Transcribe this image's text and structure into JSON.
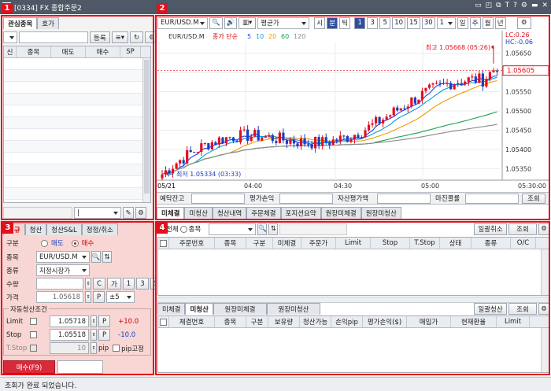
{
  "window": {
    "title": "[0334] FX 종합주문2",
    "icons": [
      "window-icon",
      "restore-icon",
      "minimize-icon",
      "link-icon",
      "font-icon",
      "help-icon",
      "settings-icon",
      "pin-icon",
      "close-icon"
    ]
  },
  "markers": [
    "1",
    "2",
    "3",
    "4"
  ],
  "watchlist": {
    "tabs": [
      "관심종목",
      "호가"
    ],
    "register_label": "등록",
    "columns": [
      "신",
      "종목",
      "매도",
      "매수",
      "SP"
    ]
  },
  "chart_toolbar": {
    "symbol": "EUR/USD.M",
    "price_type": "평균가",
    "period_buttons": [
      "시",
      "분",
      "틱"
    ],
    "intervals": [
      "1",
      "3",
      "5",
      "10",
      "15",
      "30"
    ],
    "interval_select": "1",
    "long_periods": [
      "일",
      "주",
      "월",
      "년"
    ]
  },
  "chart": {
    "legend_symbol": "EUR/USD.M",
    "legend_ma": "종가 단순",
    "ma_periods": [
      "5",
      "10",
      "20",
      "60",
      "120"
    ],
    "ma_colors": [
      "#1f3cff",
      "#0a9bd8",
      "#f29a00",
      "#17a04a",
      "#8a8a8a"
    ],
    "high_label": "최고 1.05668 (05:26)",
    "low_label": "최저 1.05334 (03:33)",
    "lc_label": "LC:0.26",
    "hc_label": "HC:-0.06",
    "current_price": "1.05605",
    "y_ticks": [
      "1.05650",
      "1.05600",
      "1.05550",
      "1.05500",
      "1.05450",
      "1.05400",
      "1.05350"
    ],
    "x_ticks": [
      "05/21",
      "04:00",
      "04:30",
      "05:00",
      "05:30:00"
    ]
  },
  "chart_data": {
    "type": "candlestick",
    "ylim": [
      1.0532,
      1.0568
    ],
    "x": [
      "05/21",
      "04:00",
      "04:30",
      "05:00",
      "05:30:00"
    ],
    "high": 1.05668,
    "low": 1.05334,
    "last": 1.05605
  },
  "account": {
    "labels": [
      "예탁잔고",
      "평가손익",
      "자산평가액",
      "마진콜률"
    ],
    "query_label": "조회"
  },
  "order_tabs": [
    "미체결",
    "미청산",
    "청산내역",
    "주문체결",
    "포지션요약",
    "원장미체결",
    "원장미청산"
  ],
  "order_panel": {
    "tabs": [
      "신규",
      "청산",
      "청산S&L",
      "정정/취소"
    ],
    "fields": {
      "side_label": "구분",
      "sell": "매도",
      "buy": "매수",
      "symbol_label": "종목",
      "symbol": "EUR/USD.M",
      "type_label": "종류",
      "type": "지정시장가",
      "qty_label": "수량",
      "qty_buttons": [
        "C",
        "가",
        "1",
        "3",
        "5"
      ],
      "price_label": "가격",
      "price": "1.05618",
      "price_p": "P",
      "price_range": "±5"
    },
    "auto_title": "자동청산조건",
    "limit_label": "Limit",
    "limit_price": "1.05718",
    "limit_p": "P",
    "limit_pips": "+10.0",
    "stop_label": "Stop",
    "stop_price": "1.05518",
    "stop_p": "P",
    "stop_pips": "-10.0",
    "tstop_label": "T.Stop",
    "tstop_value": "10",
    "tstop_unit": "pip",
    "pip_fixed": "pip고정",
    "submit_label": "매수(F9)"
  },
  "unfilled": {
    "filter_all": "전체",
    "filter_symbol": "종목",
    "cancel_all_label": "일괄취소",
    "query_label": "조회",
    "columns": [
      "주문번호",
      "종목",
      "구분",
      "미체결",
      "주문가",
      "Limit",
      "Stop",
      "T.Stop",
      "상태",
      "종류",
      "O/C"
    ]
  },
  "positions": {
    "tabs": [
      "미체결",
      "미청산",
      "원장미체결",
      "원장미청산"
    ],
    "close_all_label": "일괄청산",
    "query_label": "조회",
    "columns": [
      "체결번호",
      "종목",
      "구분",
      "보유량",
      "청산가능",
      "손익pip",
      "평가손익($)",
      "매입가",
      "현재환율",
      "Limit"
    ]
  },
  "status_message": "조회가 완료 되었습니다."
}
